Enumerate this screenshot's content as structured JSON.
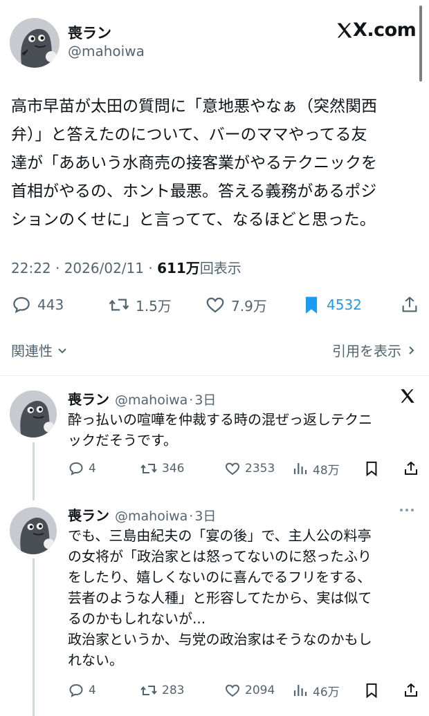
{
  "main_post": {
    "name": "喪ラン",
    "handle": "@mahoiwa",
    "brand": "X.com",
    "lines": [
      "高市早苗が太田の質問に「意地悪やなぁ（突然関西",
      "弁）」と答えたのについて、バーのママやってる友",
      "達が「ああいう水商売の接客業がやるテクニックを",
      "首相がやるの、ホント最悪。答える義務があるポジ",
      "ションのくせに」と言ってて、なるほどと思った。"
    ],
    "timestamp": "22:22 · 2026/02/11 · ",
    "views_count": "611万",
    "views_label": "回表示",
    "replies": "443",
    "reposts": "1.5万",
    "likes": "7.9万",
    "bookmarks": "4532",
    "relevance_label": "関連性",
    "quotes_label": "引用を表示"
  },
  "replies": [
    {
      "name": "喪ラン",
      "handle": "@mahoiwa",
      "dot": "·",
      "time": "3日",
      "lines": [
        "酔っ払いの喧嘩を仲裁する時の混ぜっ返しテクニ",
        "ックだそうです。"
      ],
      "replies": "4",
      "reposts": "346",
      "likes": "2353",
      "views": "48万"
    },
    {
      "name": "喪ラン",
      "handle": "@mahoiwa",
      "dot": "·",
      "time": "3日",
      "lines": [
        "でも、三島由紀夫の「宴の後」で、主人公の料亭",
        "の女将が「政治家とは怒ってないのに怒ったふり",
        "をしたり、嬉しくないのに喜んでるフリをする、",
        "芸者のような人種」と形容してたから、実は似て",
        "るのかもしれないが...",
        "政治家というか、与党の政治家はそうなのかもし",
        "れない。"
      ],
      "replies": "4",
      "reposts": "283",
      "likes": "2094",
      "views": "46万"
    }
  ],
  "colors": {
    "text": "#0f1419",
    "secondary": "#536471",
    "accent": "#1d9bf0",
    "divider": "#eff3f4"
  },
  "icons": [
    "avatar-creature",
    "x-logo-icon",
    "reply-icon",
    "repost-icon",
    "like-icon",
    "bookmark-filled-icon",
    "share-icon",
    "chevron-down-icon",
    "chevron-right-icon",
    "views-chart-icon",
    "more-icon"
  ]
}
